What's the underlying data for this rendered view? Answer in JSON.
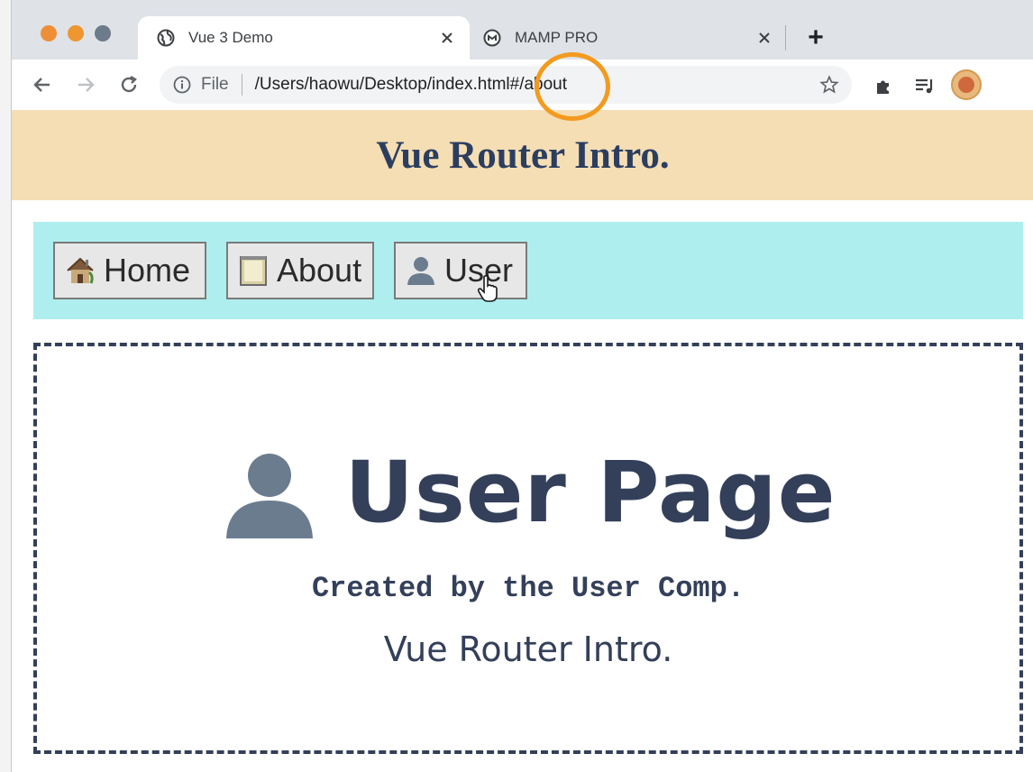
{
  "browser": {
    "tabs": [
      {
        "title": "Vue 3 Demo",
        "icon": "globe-icon",
        "active": true
      },
      {
        "title": "MAMP PRO",
        "icon": "mamp-icon",
        "active": false
      }
    ],
    "newtab_symbol": "+",
    "omnibox": {
      "scheme_label": "File",
      "url": "/Users/haowu/Desktop/index.html#/about"
    },
    "accent_colors": {
      "tabstrip": "#dfe3e8",
      "highlight": "#f39a1f"
    }
  },
  "page": {
    "header_title": "Vue Router Intro.",
    "nav": [
      {
        "label": "Home",
        "icon": "house-icon"
      },
      {
        "label": "About",
        "icon": "notepad-icon"
      },
      {
        "label": "User",
        "icon": "user-silhouette-icon"
      }
    ],
    "content": {
      "heading": "User Page",
      "heading_icon": "user-silhouette-icon",
      "subtitle": "Created by the User Comp.",
      "footer": "Vue Router Intro."
    },
    "colors": {
      "header_bg": "#f5deb3",
      "nav_bg": "#afeeee",
      "text": "#34405a"
    }
  }
}
